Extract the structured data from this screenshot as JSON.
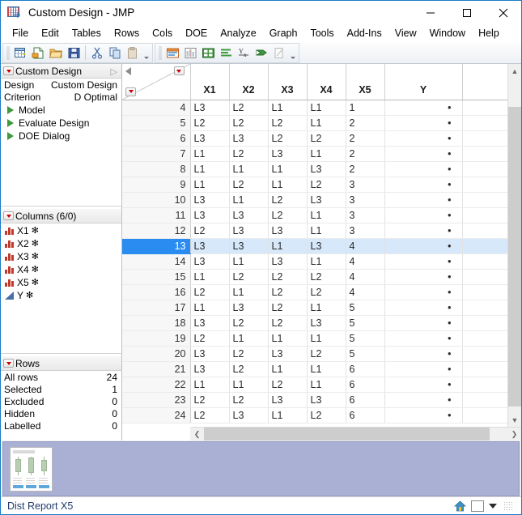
{
  "window": {
    "title": "Custom Design - JMP",
    "icon": "jmp-grid-icon",
    "minimize_label": "Minimize",
    "maximize_label": "Maximize",
    "close_label": "Close"
  },
  "menubar": {
    "items": [
      {
        "label": "File"
      },
      {
        "label": "Edit"
      },
      {
        "label": "Tables"
      },
      {
        "label": "Rows"
      },
      {
        "label": "Cols"
      },
      {
        "label": "DOE"
      },
      {
        "label": "Analyze"
      },
      {
        "label": "Graph"
      },
      {
        "label": "Tools"
      },
      {
        "label": "Add-Ins"
      },
      {
        "label": "View"
      },
      {
        "label": "Window"
      },
      {
        "label": "Help"
      }
    ]
  },
  "toolbar": {
    "group1": [
      {
        "name": "new-data-table-icon"
      },
      {
        "name": "new-script-icon"
      },
      {
        "name": "open-file-icon"
      },
      {
        "name": "save-icon"
      },
      {
        "name": "cut-icon"
      },
      {
        "name": "copy-icon"
      },
      {
        "name": "paste-icon"
      }
    ],
    "group2": [
      {
        "name": "distribution-icon"
      },
      {
        "name": "fit-y-by-x-icon"
      },
      {
        "name": "tabulate-icon"
      },
      {
        "name": "chart-icon"
      },
      {
        "name": "fit-model-icon"
      },
      {
        "name": "graph-builder-icon"
      },
      {
        "name": "script-editor-icon"
      }
    ]
  },
  "sidebar": {
    "design_panel": {
      "title": "Custom Design",
      "properties": [
        {
          "label": "Design",
          "value": "Custom Design"
        },
        {
          "label": "Criterion",
          "value": "D Optimal"
        }
      ],
      "items": [
        {
          "label": "Model"
        },
        {
          "label": "Evaluate Design"
        },
        {
          "label": "DOE Dialog"
        }
      ]
    },
    "columns_panel": {
      "title": "Columns (6/0)",
      "items": [
        {
          "label": "X1",
          "type": "nominal",
          "flag": "✻"
        },
        {
          "label": "X2",
          "type": "nominal",
          "flag": "✻"
        },
        {
          "label": "X3",
          "type": "nominal",
          "flag": "✻"
        },
        {
          "label": "X4",
          "type": "nominal",
          "flag": "✻"
        },
        {
          "label": "X5",
          "type": "nominal",
          "flag": "✻"
        },
        {
          "label": "Y",
          "type": "continuous",
          "flag": "✻"
        }
      ]
    },
    "rows_panel": {
      "title": "Rows",
      "stats": [
        {
          "label": "All rows",
          "value": "24"
        },
        {
          "label": "Selected",
          "value": "1"
        },
        {
          "label": "Excluded",
          "value": "0"
        },
        {
          "label": "Hidden",
          "value": "0"
        },
        {
          "label": "Labelled",
          "value": "0"
        }
      ]
    }
  },
  "table": {
    "columns": [
      "X1",
      "X2",
      "X3",
      "X4",
      "X5",
      "Y"
    ],
    "selected_row": 13,
    "missing_value_marker": "•",
    "rows": [
      {
        "n": "4",
        "X1": "L3",
        "X2": "L2",
        "X3": "L1",
        "X4": "L1",
        "X5": "1",
        "Y": "•"
      },
      {
        "n": "5",
        "X1": "L2",
        "X2": "L2",
        "X3": "L2",
        "X4": "L1",
        "X5": "2",
        "Y": "•"
      },
      {
        "n": "6",
        "X1": "L3",
        "X2": "L3",
        "X3": "L2",
        "X4": "L2",
        "X5": "2",
        "Y": "•"
      },
      {
        "n": "7",
        "X1": "L1",
        "X2": "L2",
        "X3": "L3",
        "X4": "L1",
        "X5": "2",
        "Y": "•"
      },
      {
        "n": "8",
        "X1": "L1",
        "X2": "L1",
        "X3": "L1",
        "X4": "L3",
        "X5": "2",
        "Y": "•"
      },
      {
        "n": "9",
        "X1": "L1",
        "X2": "L2",
        "X3": "L1",
        "X4": "L2",
        "X5": "3",
        "Y": "•"
      },
      {
        "n": "10",
        "X1": "L3",
        "X2": "L1",
        "X3": "L2",
        "X4": "L3",
        "X5": "3",
        "Y": "•"
      },
      {
        "n": "11",
        "X1": "L3",
        "X2": "L3",
        "X3": "L2",
        "X4": "L1",
        "X5": "3",
        "Y": "•"
      },
      {
        "n": "12",
        "X1": "L2",
        "X2": "L3",
        "X3": "L3",
        "X4": "L1",
        "X5": "3",
        "Y": "•"
      },
      {
        "n": "13",
        "X1": "L3",
        "X2": "L3",
        "X3": "L1",
        "X4": "L3",
        "X5": "4",
        "Y": "•"
      },
      {
        "n": "14",
        "X1": "L3",
        "X2": "L1",
        "X3": "L3",
        "X4": "L1",
        "X5": "4",
        "Y": "•"
      },
      {
        "n": "15",
        "X1": "L1",
        "X2": "L2",
        "X3": "L2",
        "X4": "L2",
        "X5": "4",
        "Y": "•"
      },
      {
        "n": "16",
        "X1": "L2",
        "X2": "L1",
        "X3": "L2",
        "X4": "L2",
        "X5": "4",
        "Y": "•"
      },
      {
        "n": "17",
        "X1": "L1",
        "X2": "L3",
        "X3": "L2",
        "X4": "L1",
        "X5": "5",
        "Y": "•"
      },
      {
        "n": "18",
        "X1": "L3",
        "X2": "L2",
        "X3": "L2",
        "X4": "L3",
        "X5": "5",
        "Y": "•"
      },
      {
        "n": "19",
        "X1": "L2",
        "X2": "L1",
        "X3": "L1",
        "X4": "L1",
        "X5": "5",
        "Y": "•"
      },
      {
        "n": "20",
        "X1": "L3",
        "X2": "L2",
        "X3": "L3",
        "X4": "L2",
        "X5": "5",
        "Y": "•"
      },
      {
        "n": "21",
        "X1": "L3",
        "X2": "L2",
        "X3": "L1",
        "X4": "L1",
        "X5": "6",
        "Y": "•"
      },
      {
        "n": "22",
        "X1": "L1",
        "X2": "L1",
        "X3": "L2",
        "X4": "L1",
        "X5": "6",
        "Y": "•"
      },
      {
        "n": "23",
        "X1": "L2",
        "X2": "L2",
        "X3": "L3",
        "X4": "L3",
        "X5": "6",
        "Y": "•"
      },
      {
        "n": "24",
        "X1": "L2",
        "X2": "L3",
        "X3": "L1",
        "X4": "L2",
        "X5": "6",
        "Y": "•"
      }
    ]
  },
  "report_strip": {
    "thumbnail_name": "distribution-report-thumbnail"
  },
  "statusbar": {
    "text": "Dist Report X5",
    "icons": [
      "home-icon",
      "window-box-icon",
      "dropdown-caret-icon"
    ]
  },
  "colors": {
    "selection_blue": "#2a8cf0",
    "selection_row_fill": "#d6e8f9",
    "window_border": "#1a7cc4",
    "report_strip": "#aab0d4",
    "status_text": "#1f3b6e",
    "nominal_icon": "#c0392b",
    "continuous_icon": "#4a6fa5",
    "tree_triangle": "#3c9a3c",
    "red_dropdown": "#cc0000"
  }
}
